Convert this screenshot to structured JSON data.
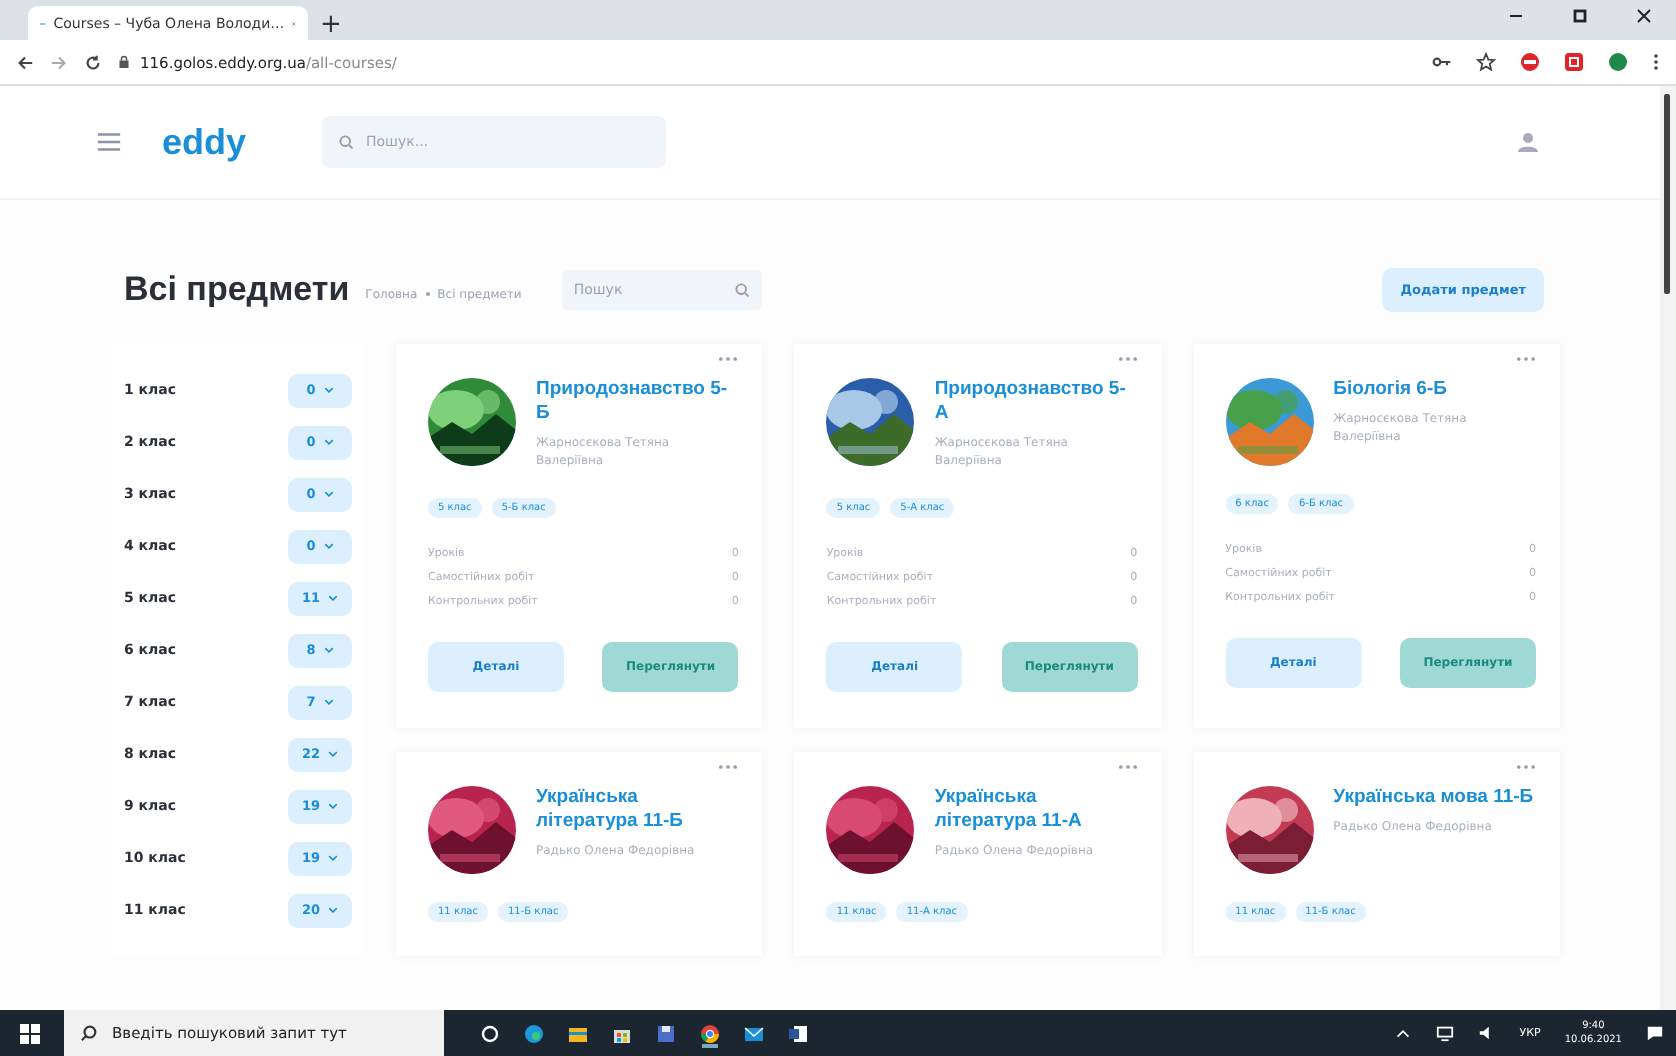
{
  "browser": {
    "tab_title": "Courses – Чуба Олена Володи…",
    "new_tab": "+",
    "url_host": "116.golos.eddy.org.ua",
    "url_path": "/all-courses/"
  },
  "header": {
    "logo": "eddy",
    "search": {
      "placeholder": "Пошук..."
    }
  },
  "page": {
    "title": "Всі предмети",
    "breadcrumbs": [
      "Головна",
      "Всі предмети"
    ],
    "search": {
      "placeholder": "Пошук"
    },
    "add_button": "Додати предмет"
  },
  "sidebar": {
    "items": [
      {
        "label": "1 клас",
        "count": "0"
      },
      {
        "label": "2 клас",
        "count": "0"
      },
      {
        "label": "3 клас",
        "count": "0"
      },
      {
        "label": "4 клас",
        "count": "0"
      },
      {
        "label": "5 клас",
        "count": "11"
      },
      {
        "label": "6 клас",
        "count": "8"
      },
      {
        "label": "7 клас",
        "count": "7"
      },
      {
        "label": "8 клас",
        "count": "22"
      },
      {
        "label": "9 клас",
        "count": "19"
      },
      {
        "label": "10 клас",
        "count": "19"
      },
      {
        "label": "11 клас",
        "count": "20"
      }
    ]
  },
  "courses": [
    {
      "title": "Природознавство 5-Б",
      "teacher": "Жарносєкова Тетяна Валеріївна",
      "tags": [
        "5 клас",
        "5-Б клас"
      ],
      "stats": [
        {
          "label": "Уроків",
          "value": "0"
        },
        {
          "label": "Самостійних робіт",
          "value": "0"
        },
        {
          "label": "Контрольних робіт",
          "value": "0"
        }
      ],
      "buttons": [
        "Деталі",
        "Переглянути"
      ]
    },
    {
      "title": "Природознавство 5-А",
      "teacher": "Жарносєкова Тетяна Валеріївна",
      "tags": [
        "5 клас",
        "5-А клас"
      ],
      "stats": [
        {
          "label": "Уроків",
          "value": "0"
        },
        {
          "label": "Самостійних робіт",
          "value": "0"
        },
        {
          "label": "Контрольних робіт",
          "value": "0"
        }
      ],
      "buttons": [
        "Деталі",
        "Переглянути"
      ]
    },
    {
      "title": "Біологія 6-Б",
      "teacher": "Жарносєкова Тетяна Валеріївна",
      "tags": [
        "6 клас",
        "6-Б клас"
      ],
      "stats": [
        {
          "label": "Уроків",
          "value": "0"
        },
        {
          "label": "Самостійних робіт",
          "value": "0"
        },
        {
          "label": "Контрольних робіт",
          "value": "0"
        }
      ],
      "buttons": [
        "Деталі",
        "Переглянути"
      ]
    },
    {
      "title": "Українська література 11-Б",
      "teacher": "Радько Олена Федорівна",
      "tags": [
        "11 клас",
        "11-Б клас"
      ]
    },
    {
      "title": "Українська література 11-А",
      "teacher": "Радько Олена Федорівна",
      "tags": [
        "11 клас",
        "11-А клас"
      ]
    },
    {
      "title": "Українська мова 11-Б",
      "teacher": "Радько Олена Федорівна",
      "tags": [
        "11 клас",
        "11-Б клас"
      ]
    }
  ],
  "taskbar": {
    "search": {
      "placeholder": "Введіть пошуковий запит тут"
    },
    "language": "УКР",
    "time": "9:40",
    "date": "10.06.2021"
  }
}
